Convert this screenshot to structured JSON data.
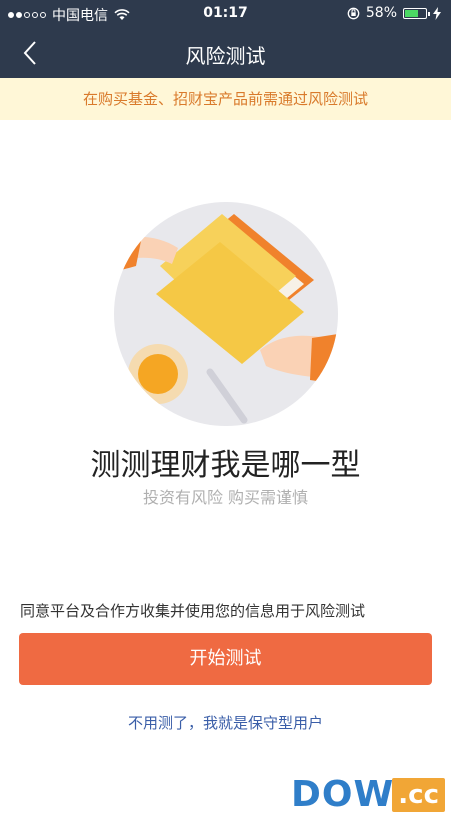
{
  "status_bar": {
    "carrier": "中国电信",
    "time": "01:17",
    "battery_percent": "58%",
    "battery_level": 0.58
  },
  "nav": {
    "title": "风险测试"
  },
  "notice": {
    "text": "在购买基金、招财宝产品前需通过风险测试"
  },
  "main": {
    "headline": "测测理财我是哪一型",
    "subline": "投资有风险 购买需谨慎",
    "consent": "同意平台及合作方收集并使用您的信息用于风险测试",
    "start_button": "开始测试",
    "skip_link": "不用测了，我就是保守型用户"
  },
  "watermark": {
    "text": "DOWN",
    "suffix": ".cc"
  },
  "colors": {
    "header_bg": "#2e3a4d",
    "notice_bg": "#fff7d7",
    "notice_text": "#d97a2b",
    "primary_button": "#ef6a42",
    "link": "#3a5ea8"
  }
}
